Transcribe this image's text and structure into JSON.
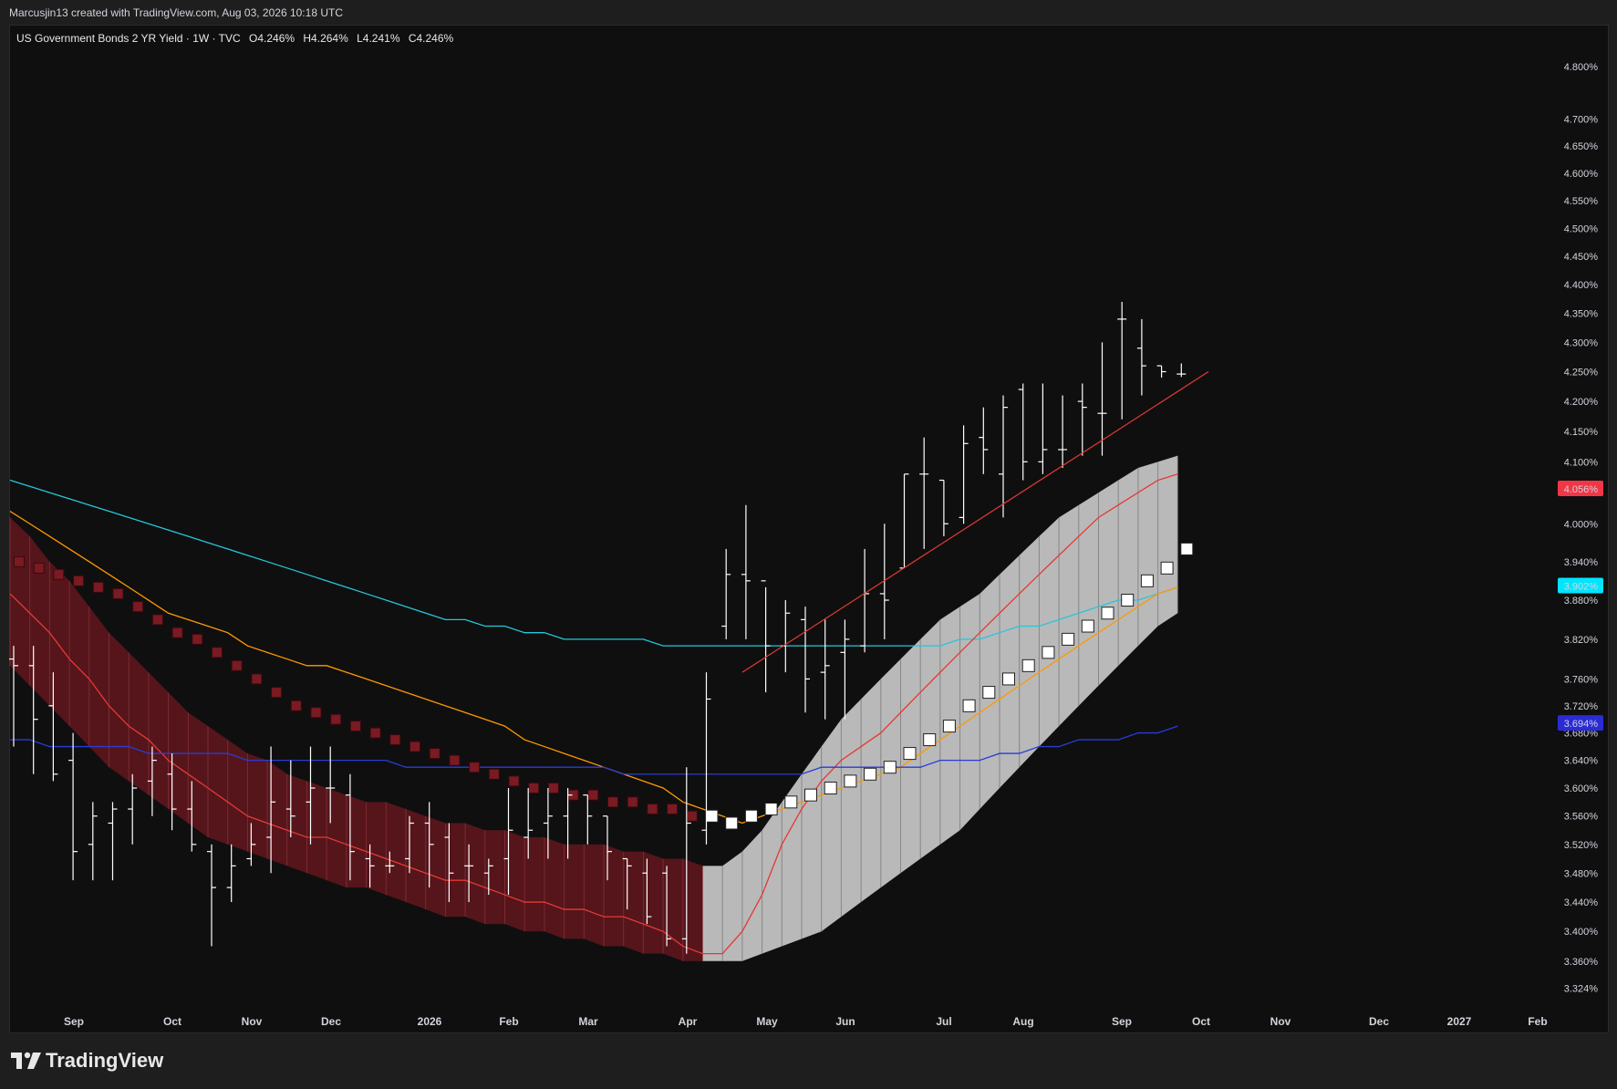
{
  "header": {
    "credit": "Marcusjin13 created with TradingView.com, Aug 03, 2026 10:18 UTC"
  },
  "legend": {
    "symbol": "US Government Bonds 2 YR Yield · 1W · TVC",
    "open": "O4.246%",
    "high": "H4.264%",
    "low": "L4.241%",
    "close": "C4.246%"
  },
  "footer": {
    "brand": "TradingView"
  },
  "colors": {
    "background": "#0f0f0f",
    "bar": "#ffffff",
    "ma_fast": "#e53935",
    "ma_mid": "#ff9800",
    "ma_cyan": "#26c6da",
    "ma_blue": "#2b3bd6",
    "trend_line": "#e53935",
    "band_down": "#7a1c24",
    "band_up": "#c8c8c8"
  },
  "chart_data": {
    "type": "ohlc",
    "title": "",
    "interval": "1W",
    "y_scale": "log",
    "ylim": [
      3.31,
      4.84
    ],
    "y_ticks": [
      "4.800%",
      "4.700%",
      "4.650%",
      "4.600%",
      "4.550%",
      "4.500%",
      "4.450%",
      "4.400%",
      "4.350%",
      "4.300%",
      "4.250%",
      "4.200%",
      "4.150%",
      "4.100%",
      "4.000%",
      "3.940%",
      "3.880%",
      "3.820%",
      "3.760%",
      "3.720%",
      "3.680%",
      "3.640%",
      "3.600%",
      "3.560%",
      "3.520%",
      "3.480%",
      "3.440%",
      "3.400%",
      "3.360%",
      "3.324%"
    ],
    "x_ticks": [
      "Sep",
      "Oct",
      "Nov",
      "Dec",
      "2026",
      "Feb",
      "Mar",
      "Apr",
      "May",
      "Jun",
      "Jul",
      "Aug",
      "Sep",
      "Oct",
      "Nov",
      "Dec",
      "2027",
      "Feb"
    ],
    "x_tick_bold": [
      "2026",
      "2027"
    ],
    "price_labels": [
      {
        "value": 4.056,
        "text": "4.056%",
        "color": "#f23645"
      },
      {
        "value": 3.902,
        "text": "3.902%",
        "color": "#00e5ff"
      },
      {
        "value": 3.694,
        "text": "3.694%",
        "color": "#2b2bd6"
      }
    ],
    "bars": [
      {
        "o": 3.79,
        "h": 3.81,
        "l": 3.66,
        "c": 3.78
      },
      {
        "o": 3.78,
        "h": 3.81,
        "l": 3.62,
        "c": 3.7
      },
      {
        "o": 3.72,
        "h": 3.77,
        "l": 3.61,
        "c": 3.62
      },
      {
        "o": 3.64,
        "h": 3.68,
        "l": 3.47,
        "c": 3.51
      },
      {
        "o": 3.52,
        "h": 3.58,
        "l": 3.47,
        "c": 3.56
      },
      {
        "o": 3.55,
        "h": 3.58,
        "l": 3.47,
        "c": 3.57
      },
      {
        "o": 3.57,
        "h": 3.62,
        "l": 3.52,
        "c": 3.6
      },
      {
        "o": 3.61,
        "h": 3.66,
        "l": 3.56,
        "c": 3.64
      },
      {
        "o": 3.62,
        "h": 3.65,
        "l": 3.54,
        "c": 3.57
      },
      {
        "o": 3.57,
        "h": 3.61,
        "l": 3.51,
        "c": 3.52
      },
      {
        "o": 3.51,
        "h": 3.52,
        "l": 3.38,
        "c": 3.46
      },
      {
        "o": 3.46,
        "h": 3.52,
        "l": 3.44,
        "c": 3.49
      },
      {
        "o": 3.5,
        "h": 3.55,
        "l": 3.49,
        "c": 3.52
      },
      {
        "o": 3.53,
        "h": 3.66,
        "l": 3.48,
        "c": 3.58
      },
      {
        "o": 3.57,
        "h": 3.64,
        "l": 3.53,
        "c": 3.56
      },
      {
        "o": 3.58,
        "h": 3.66,
        "l": 3.52,
        "c": 3.6
      },
      {
        "o": 3.6,
        "h": 3.66,
        "l": 3.55,
        "c": 3.6
      },
      {
        "o": 3.59,
        "h": 3.62,
        "l": 3.47,
        "c": 3.51
      },
      {
        "o": 3.5,
        "h": 3.52,
        "l": 3.46,
        "c": 3.49
      },
      {
        "o": 3.49,
        "h": 3.51,
        "l": 3.48,
        "c": 3.49
      },
      {
        "o": 3.5,
        "h": 3.56,
        "l": 3.48,
        "c": 3.55
      },
      {
        "o": 3.55,
        "h": 3.58,
        "l": 3.46,
        "c": 3.52
      },
      {
        "o": 3.53,
        "h": 3.55,
        "l": 3.44,
        "c": 3.48
      },
      {
        "o": 3.49,
        "h": 3.52,
        "l": 3.44,
        "c": 3.49
      },
      {
        "o": 3.48,
        "h": 3.5,
        "l": 3.45,
        "c": 3.49
      },
      {
        "o": 3.5,
        "h": 3.6,
        "l": 3.45,
        "c": 3.54
      },
      {
        "o": 3.53,
        "h": 3.6,
        "l": 3.5,
        "c": 3.54
      },
      {
        "o": 3.55,
        "h": 3.6,
        "l": 3.5,
        "c": 3.56
      },
      {
        "o": 3.56,
        "h": 3.6,
        "l": 3.5,
        "c": 3.59
      },
      {
        "o": 3.59,
        "h": 3.59,
        "l": 3.52,
        "c": 3.56
      },
      {
        "o": 3.56,
        "h": 3.56,
        "l": 3.47,
        "c": 3.51
      },
      {
        "o": 3.5,
        "h": 3.5,
        "l": 3.43,
        "c": 3.49
      },
      {
        "o": 3.48,
        "h": 3.5,
        "l": 3.41,
        "c": 3.42
      },
      {
        "o": 3.48,
        "h": 3.49,
        "l": 3.38,
        "c": 3.39
      },
      {
        "o": 3.39,
        "h": 3.63,
        "l": 3.37,
        "c": 3.55
      },
      {
        "o": 3.54,
        "h": 3.77,
        "l": 3.52,
        "c": 3.73
      },
      {
        "o": 3.84,
        "h": 3.96,
        "l": 3.82,
        "c": 3.92
      },
      {
        "o": 3.92,
        "h": 4.03,
        "l": 3.82,
        "c": 3.91
      },
      {
        "o": 3.91,
        "h": 3.9,
        "l": 3.74,
        "c": 3.81
      },
      {
        "o": 3.81,
        "h": 3.88,
        "l": 3.77,
        "c": 3.86
      },
      {
        "o": 3.85,
        "h": 3.87,
        "l": 3.71,
        "c": 3.76
      },
      {
        "o": 3.77,
        "h": 3.85,
        "l": 3.7,
        "c": 3.78
      },
      {
        "o": 3.8,
        "h": 3.85,
        "l": 3.7,
        "c": 3.82
      },
      {
        "o": 3.81,
        "h": 3.96,
        "l": 3.8,
        "c": 3.89
      },
      {
        "o": 3.89,
        "h": 4.0,
        "l": 3.82,
        "c": 3.88
      },
      {
        "o": 3.93,
        "h": 4.08,
        "l": 3.93,
        "c": 4.08
      },
      {
        "o": 4.08,
        "h": 4.14,
        "l": 3.96,
        "c": 4.08
      },
      {
        "o": 4.07,
        "h": 4.07,
        "l": 3.98,
        "c": 4.0
      },
      {
        "o": 4.01,
        "h": 4.16,
        "l": 4.0,
        "c": 4.13
      },
      {
        "o": 4.14,
        "h": 4.19,
        "l": 4.08,
        "c": 4.12
      },
      {
        "o": 4.08,
        "h": 4.21,
        "l": 4.01,
        "c": 4.19
      },
      {
        "o": 4.22,
        "h": 4.23,
        "l": 4.07,
        "c": 4.1
      },
      {
        "o": 4.1,
        "h": 4.23,
        "l": 4.08,
        "c": 4.12
      },
      {
        "o": 4.12,
        "h": 4.21,
        "l": 4.09,
        "c": 4.12
      },
      {
        "o": 4.2,
        "h": 4.23,
        "l": 4.11,
        "c": 4.19
      },
      {
        "o": 4.18,
        "h": 4.3,
        "l": 4.11,
        "c": 4.18
      },
      {
        "o": 4.34,
        "h": 4.37,
        "l": 4.17,
        "c": 4.34
      },
      {
        "o": 4.29,
        "h": 4.34,
        "l": 4.21,
        "c": 4.26
      },
      {
        "o": 4.26,
        "h": 4.26,
        "l": 4.24,
        "c": 4.25
      },
      {
        "o": 4.246,
        "h": 4.264,
        "l": 4.241,
        "c": 4.246
      }
    ],
    "series": [
      {
        "color": "#26c6da",
        "values": [
          4.07,
          4.06,
          4.05,
          4.04,
          4.03,
          4.02,
          4.01,
          4.0,
          3.99,
          3.98,
          3.97,
          3.96,
          3.95,
          3.94,
          3.93,
          3.92,
          3.91,
          3.9,
          3.89,
          3.88,
          3.87,
          3.86,
          3.85,
          3.85,
          3.84,
          3.84,
          3.83,
          3.83,
          3.82,
          3.82,
          3.82,
          3.82,
          3.82,
          3.81,
          3.81,
          3.81,
          3.81,
          3.81,
          3.81,
          3.81,
          3.81,
          3.81,
          3.81,
          3.81,
          3.81,
          3.81,
          3.81,
          3.81,
          3.82,
          3.82,
          3.83,
          3.84,
          3.84,
          3.85,
          3.86,
          3.87,
          3.88,
          3.88,
          3.89,
          3.9
        ]
      },
      {
        "color": "#ff9800",
        "values": [
          4.02,
          4.0,
          3.98,
          3.96,
          3.94,
          3.92,
          3.9,
          3.88,
          3.86,
          3.85,
          3.84,
          3.83,
          3.81,
          3.8,
          3.79,
          3.78,
          3.78,
          3.77,
          3.76,
          3.75,
          3.74,
          3.73,
          3.72,
          3.71,
          3.7,
          3.69,
          3.67,
          3.66,
          3.65,
          3.64,
          3.63,
          3.62,
          3.61,
          3.6,
          3.58,
          3.57,
          3.56,
          3.55,
          3.56,
          3.57,
          3.58,
          3.59,
          3.6,
          3.61,
          3.62,
          3.63,
          3.65,
          3.67,
          3.69,
          3.71,
          3.73,
          3.75,
          3.77,
          3.79,
          3.81,
          3.83,
          3.85,
          3.87,
          3.89,
          3.9
        ]
      },
      {
        "color": "#e53935",
        "values": [
          3.89,
          3.86,
          3.83,
          3.79,
          3.76,
          3.72,
          3.69,
          3.67,
          3.64,
          3.62,
          3.6,
          3.58,
          3.56,
          3.55,
          3.54,
          3.53,
          3.53,
          3.52,
          3.51,
          3.5,
          3.49,
          3.48,
          3.47,
          3.47,
          3.46,
          3.45,
          3.44,
          3.44,
          3.43,
          3.43,
          3.42,
          3.42,
          3.41,
          3.4,
          3.38,
          3.37,
          3.37,
          3.4,
          3.45,
          3.52,
          3.57,
          3.61,
          3.64,
          3.66,
          3.68,
          3.71,
          3.74,
          3.77,
          3.8,
          3.83,
          3.86,
          3.89,
          3.92,
          3.95,
          3.98,
          4.01,
          4.03,
          4.05,
          4.07,
          4.08
        ]
      },
      {
        "color": "#2b3bd6",
        "values": [
          3.67,
          3.67,
          3.66,
          3.66,
          3.66,
          3.66,
          3.66,
          3.65,
          3.65,
          3.65,
          3.65,
          3.65,
          3.64,
          3.64,
          3.64,
          3.64,
          3.64,
          3.64,
          3.64,
          3.64,
          3.63,
          3.63,
          3.63,
          3.63,
          3.63,
          3.63,
          3.63,
          3.63,
          3.63,
          3.63,
          3.63,
          3.62,
          3.62,
          3.62,
          3.62,
          3.62,
          3.62,
          3.62,
          3.62,
          3.62,
          3.62,
          3.63,
          3.63,
          3.63,
          3.63,
          3.63,
          3.63,
          3.64,
          3.64,
          3.64,
          3.65,
          3.65,
          3.66,
          3.66,
          3.67,
          3.67,
          3.67,
          3.68,
          3.68,
          3.69
        ]
      }
    ],
    "band": {
      "upper": [
        4.01,
        3.98,
        3.94,
        3.91,
        3.87,
        3.83,
        3.8,
        3.77,
        3.74,
        3.71,
        3.69,
        3.67,
        3.65,
        3.64,
        3.62,
        3.61,
        3.6,
        3.59,
        3.58,
        3.58,
        3.57,
        3.56,
        3.55,
        3.55,
        3.54,
        3.54,
        3.53,
        3.53,
        3.52,
        3.52,
        3.52,
        3.51,
        3.51,
        3.5,
        3.5,
        3.49,
        3.49,
        3.51,
        3.54,
        3.58,
        3.62,
        3.66,
        3.7,
        3.73,
        3.76,
        3.79,
        3.82,
        3.85,
        3.87,
        3.89,
        3.92,
        3.95,
        3.98,
        4.01,
        4.03,
        4.05,
        4.07,
        4.09,
        4.1,
        4.11
      ],
      "lower": [
        3.78,
        3.75,
        3.72,
        3.69,
        3.66,
        3.63,
        3.61,
        3.59,
        3.57,
        3.55,
        3.53,
        3.52,
        3.51,
        3.5,
        3.49,
        3.48,
        3.47,
        3.46,
        3.46,
        3.45,
        3.44,
        3.43,
        3.42,
        3.42,
        3.41,
        3.41,
        3.4,
        3.4,
        3.39,
        3.39,
        3.38,
        3.38,
        3.37,
        3.37,
        3.36,
        3.36,
        3.36,
        3.36,
        3.37,
        3.38,
        3.39,
        3.4,
        3.42,
        3.44,
        3.46,
        3.48,
        3.5,
        3.52,
        3.54,
        3.57,
        3.6,
        3.63,
        3.66,
        3.69,
        3.72,
        3.75,
        3.78,
        3.81,
        3.84,
        3.86
      ],
      "turn_index": 35
    },
    "squares": [
      3.94,
      3.93,
      3.92,
      3.91,
      3.9,
      3.89,
      3.87,
      3.85,
      3.83,
      3.82,
      3.8,
      3.78,
      3.76,
      3.74,
      3.72,
      3.71,
      3.7,
      3.69,
      3.68,
      3.67,
      3.66,
      3.65,
      3.64,
      3.63,
      3.62,
      3.61,
      3.6,
      3.6,
      3.59,
      3.59,
      3.58,
      3.58,
      3.57,
      3.57,
      3.56,
      3.56,
      3.55,
      3.56,
      3.57,
      3.58,
      3.59,
      3.6,
      3.61,
      3.62,
      3.63,
      3.65,
      3.67,
      3.69,
      3.72,
      3.74,
      3.76,
      3.78,
      3.8,
      3.82,
      3.84,
      3.86,
      3.88,
      3.91,
      3.93,
      3.96
    ],
    "trend_line": {
      "from": {
        "bar": 37,
        "value": 3.77
      },
      "to": {
        "bar": 60,
        "value": 4.25
      }
    }
  }
}
